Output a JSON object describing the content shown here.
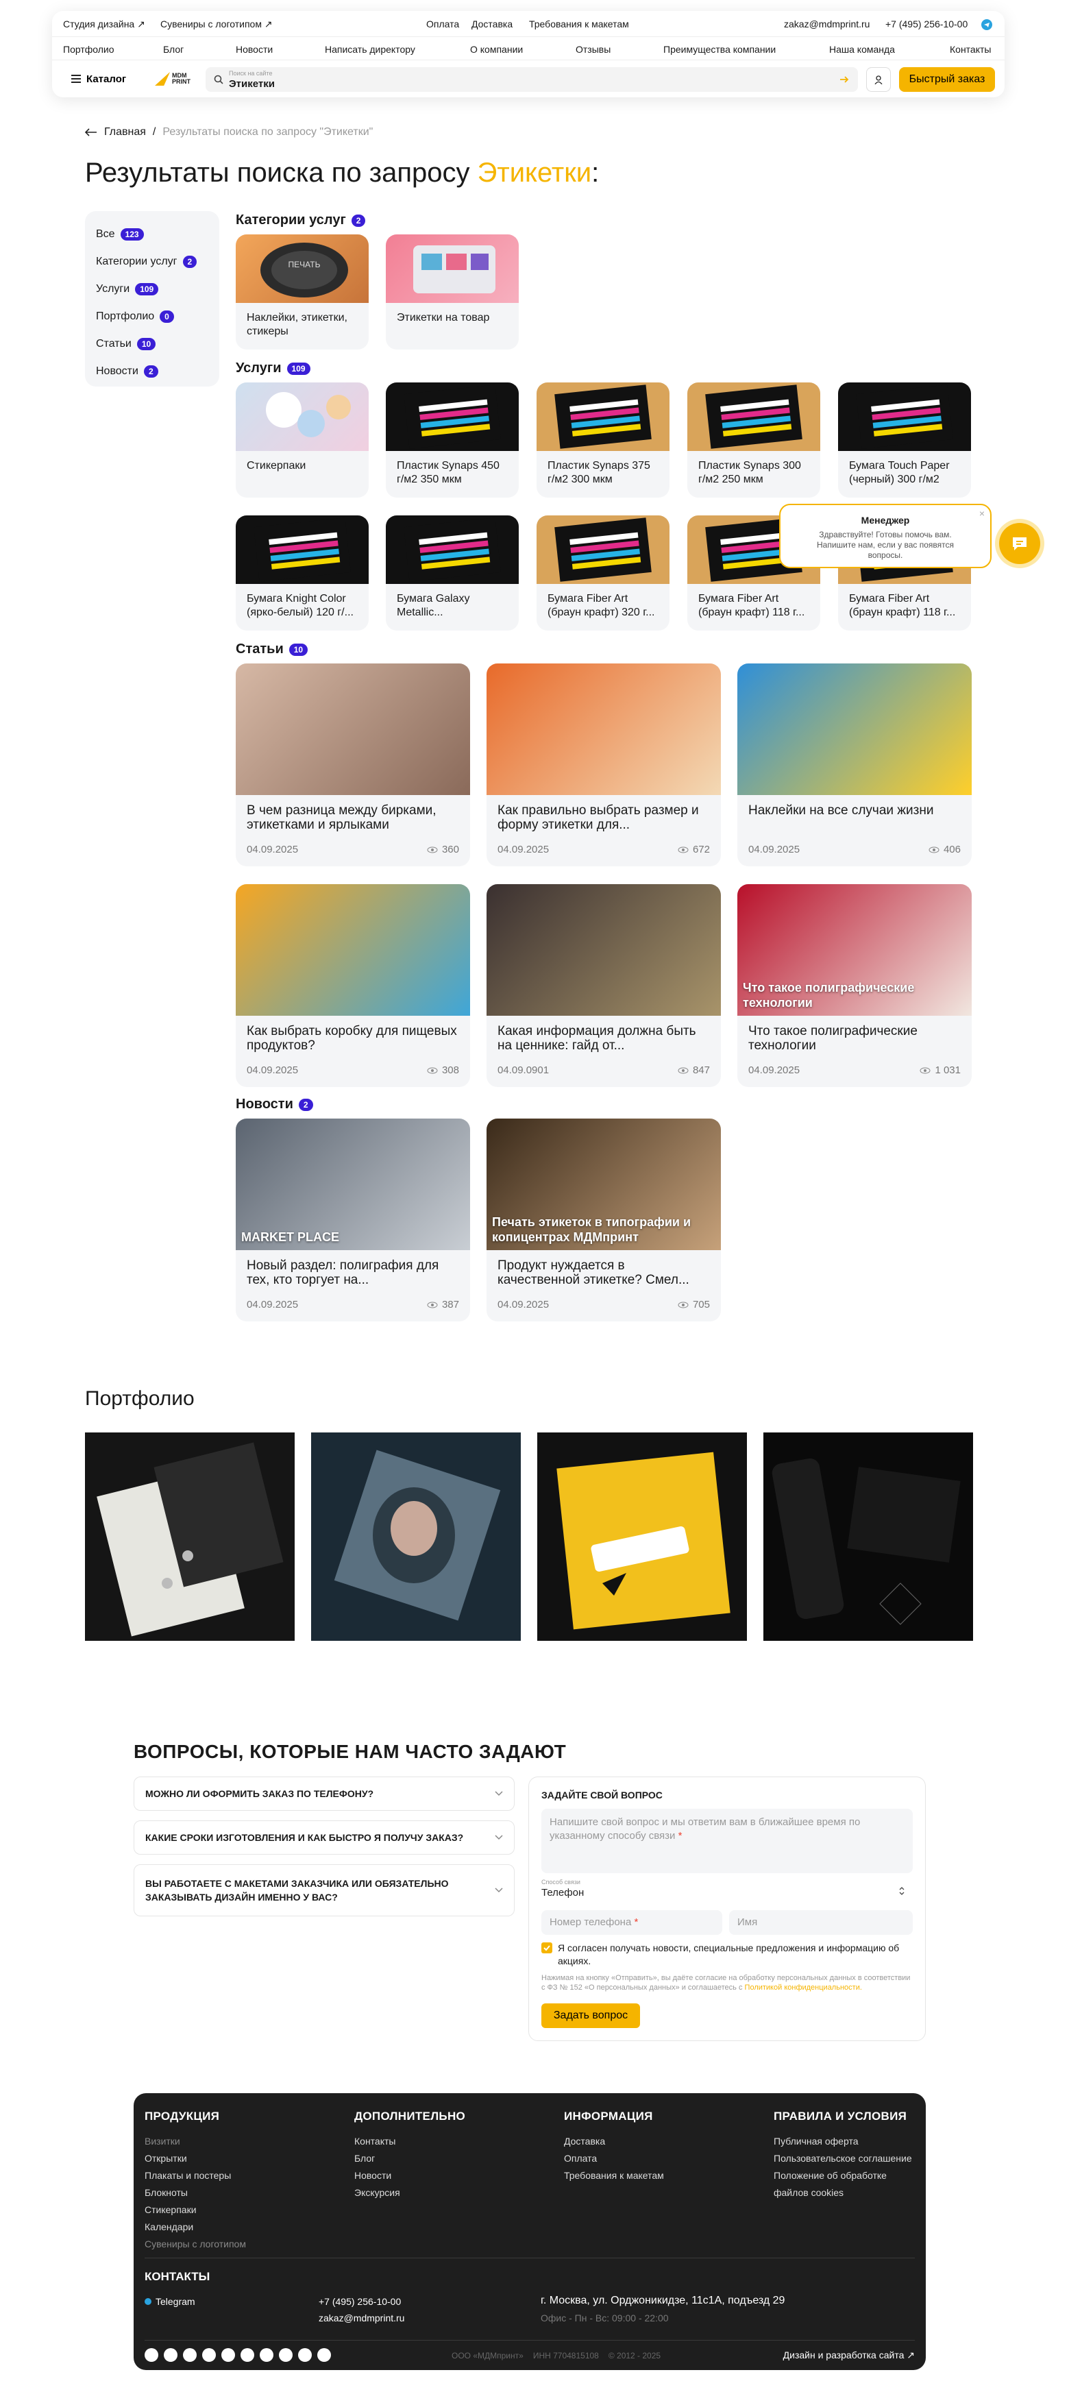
{
  "header": {
    "top_links": [
      "Студия дизайна ↗",
      "Сувениры с логотипом ↗",
      "Оплата",
      "Доставка",
      "Требования к макетам"
    ],
    "email": "zakaz@mdmprint.ru",
    "phone": "+7 (495) 256-10-00",
    "nav": [
      "Портфолио",
      "Блог",
      "Новости",
      "Написать директору",
      "О компании",
      "Отзывы",
      "Преимущества компании",
      "Наша команда",
      "Контакты"
    ],
    "catalog_label": "Каталог",
    "logo_text_1": "MDM",
    "logo_text_2": "PRINT",
    "search_label": "Поиск на сайте",
    "search_value": "Этикетки",
    "quick_order_label": "Быстрый заказ",
    "accent_color": "#f5b400"
  },
  "breadcrumb": {
    "home": "Главная",
    "current": "Результаты поиска по запросу \"Этикетки\""
  },
  "page_title": {
    "prefix": "Результаты поиска по запросу ",
    "query": "Этикетки",
    "suffix": ":"
  },
  "sidebar": {
    "items": [
      {
        "label": "Все",
        "count": "123"
      },
      {
        "label": "Категории услуг",
        "count": "2"
      },
      {
        "label": "Услуги",
        "count": "109"
      },
      {
        "label": "Портфолио",
        "count": "0"
      },
      {
        "label": "Статьи",
        "count": "10"
      },
      {
        "label": "Новости",
        "count": "2"
      }
    ]
  },
  "sections": {
    "categories": {
      "title": "Категории услуг",
      "count": "2"
    },
    "services": {
      "title": "Услуги",
      "count": "109"
    },
    "articles": {
      "title": "Статьи",
      "count": "10"
    },
    "news": {
      "title": "Новости",
      "count": "2"
    }
  },
  "categories": [
    "Наклейки, этикетки, стикеры",
    "Этикетки на товар"
  ],
  "services": [
    "Стикерпаки",
    "Пластик Synaps 450 г/м2 350 мкм",
    "Пластик Synaps 375 г/м2 300 мкм",
    "Пластик Synaps 300 г/м2 250 мкм",
    "Бумага Touch Paper (черный) 300 г/м2",
    "Бумага Knight Color (ярко-белый) 120 г/...",
    "Бумага Galaxy Metallic...",
    "Бумага Fiber Art (браун крафт) 320 г...",
    "Бумага Fiber Art (браун крафт) 118 г...",
    "Бумага Fiber Art (браун крафт) 118 г..."
  ],
  "articles": [
    {
      "title": "В чем разница между бирками, этикетками и ярлыками",
      "date": "04.09.2025",
      "views": "360"
    },
    {
      "title": "Как правильно выбрать размер и форму этикетки для...",
      "date": "04.09.2025",
      "views": "672"
    },
    {
      "title": "Наклейки на все случаи жизни",
      "date": "04.09.2025",
      "views": "406"
    },
    {
      "title": "Как выбрать коробку для пищевых продуктов?",
      "date": "04.09.2025",
      "views": "308"
    },
    {
      "title": "Какая информация должна быть на ценнике: гайд от...",
      "date": "04.09.0901",
      "views": "847"
    },
    {
      "title": "Что такое полиграфические технологии",
      "date": "04.09.2025",
      "views": "1 031",
      "overlay": "Что такое полиграфические технологии"
    }
  ],
  "news": [
    {
      "title": "Новый раздел: полиграфия для тех, кто торгует на...",
      "date": "04.09.2025",
      "views": "387",
      "overlay": "MARKET PLACE"
    },
    {
      "title": "Продукт нуждается в качественной этикетке? Смел...",
      "date": "04.09.2025",
      "views": "705",
      "overlay": "Печать этикеток в типографии и копицентрах МДМпринт"
    }
  ],
  "chat": {
    "name": "Менеджер",
    "message": "Здравствуйте! Готовы помочь вам. Напишите нам, если у вас появятся вопросы."
  },
  "portfolio": {
    "title": "Портфолио"
  },
  "faq": {
    "title": "ВОПРОСЫ, КОТОРЫЕ НАМ ЧАСТО ЗАДАЮТ",
    "items": [
      "МОЖНО ЛИ ОФОРМИТЬ ЗАКАЗ ПО ТЕЛЕФОНУ?",
      "КАКИЕ СРОКИ ИЗГОТОВЛЕНИЯ И КАК БЫСТРО Я ПОЛУЧУ ЗАКАЗ?",
      "ВЫ РАБОТАЕТЕ С МАКЕТАМИ ЗАКАЗЧИКА ИЛИ ОБЯЗАТЕЛЬНО ЗАКАЗЫВАТЬ ДИЗАЙН ИМЕННО У ВАС?"
    ]
  },
  "form": {
    "title": "ЗАДАЙТЕ СВОЙ ВОПРОС",
    "question_placeholder": "Напишите свой вопрос и мы ответим вам в ближайшее время по указанному способу связи",
    "contact_label": "Способ связи",
    "contact_value": "Телефон",
    "phone_placeholder": "Номер телефона",
    "name_placeholder": "Имя",
    "consent_label": "Я согласен получать новости, специальные предложения и информацию об акциях.",
    "legal_text": "Нажимая на кнопку «Отправить», вы даёте согласие на обработку персональных данных в соответствии с ФЗ № 152 «О персональных данных» и соглашаетесь с",
    "legal_link": "Политикой конфиденциальности.",
    "submit_label": "Задать вопрос"
  },
  "footer": {
    "cols": [
      {
        "title": "ПРОДУКЦИЯ",
        "links": [
          "Визитки",
          "Открытки",
          "Плакаты и постеры",
          "Блокноты",
          "Стикерпаки",
          "Календари",
          "Сувениры с логотипом"
        ]
      },
      {
        "title": "ДОПОЛНИТЕЛЬНО",
        "links": [
          "Контакты",
          "Блог",
          "Новости",
          "Экскурсия"
        ]
      },
      {
        "title": "ИНФОРМАЦИЯ",
        "links": [
          "Доставка",
          "Оплата",
          "Требования к макетам"
        ]
      },
      {
        "title": "ПРАВИЛА И УСЛОВИЯ",
        "links": [
          "Публичная оферта",
          "Пользовательское соглашение",
          "Положение об обработке файлов cookies"
        ]
      }
    ],
    "contacts_title": "КОНТАКТЫ",
    "telegram": "Telegram",
    "phone": "+7 (495) 256-10-00",
    "email": "zakaz@mdmprint.ru",
    "address": "г. Москва, ул. Орджоникидзе, 11с1А, подъезд 29",
    "hours": "Офис - Пн - Вс: 09:00 - 22:00",
    "company": "ООО «МДМпринт»",
    "inn": "ИНН 7704815108",
    "years": "© 2012 - 2025",
    "dev": "Дизайн и разработка сайта ↗"
  }
}
